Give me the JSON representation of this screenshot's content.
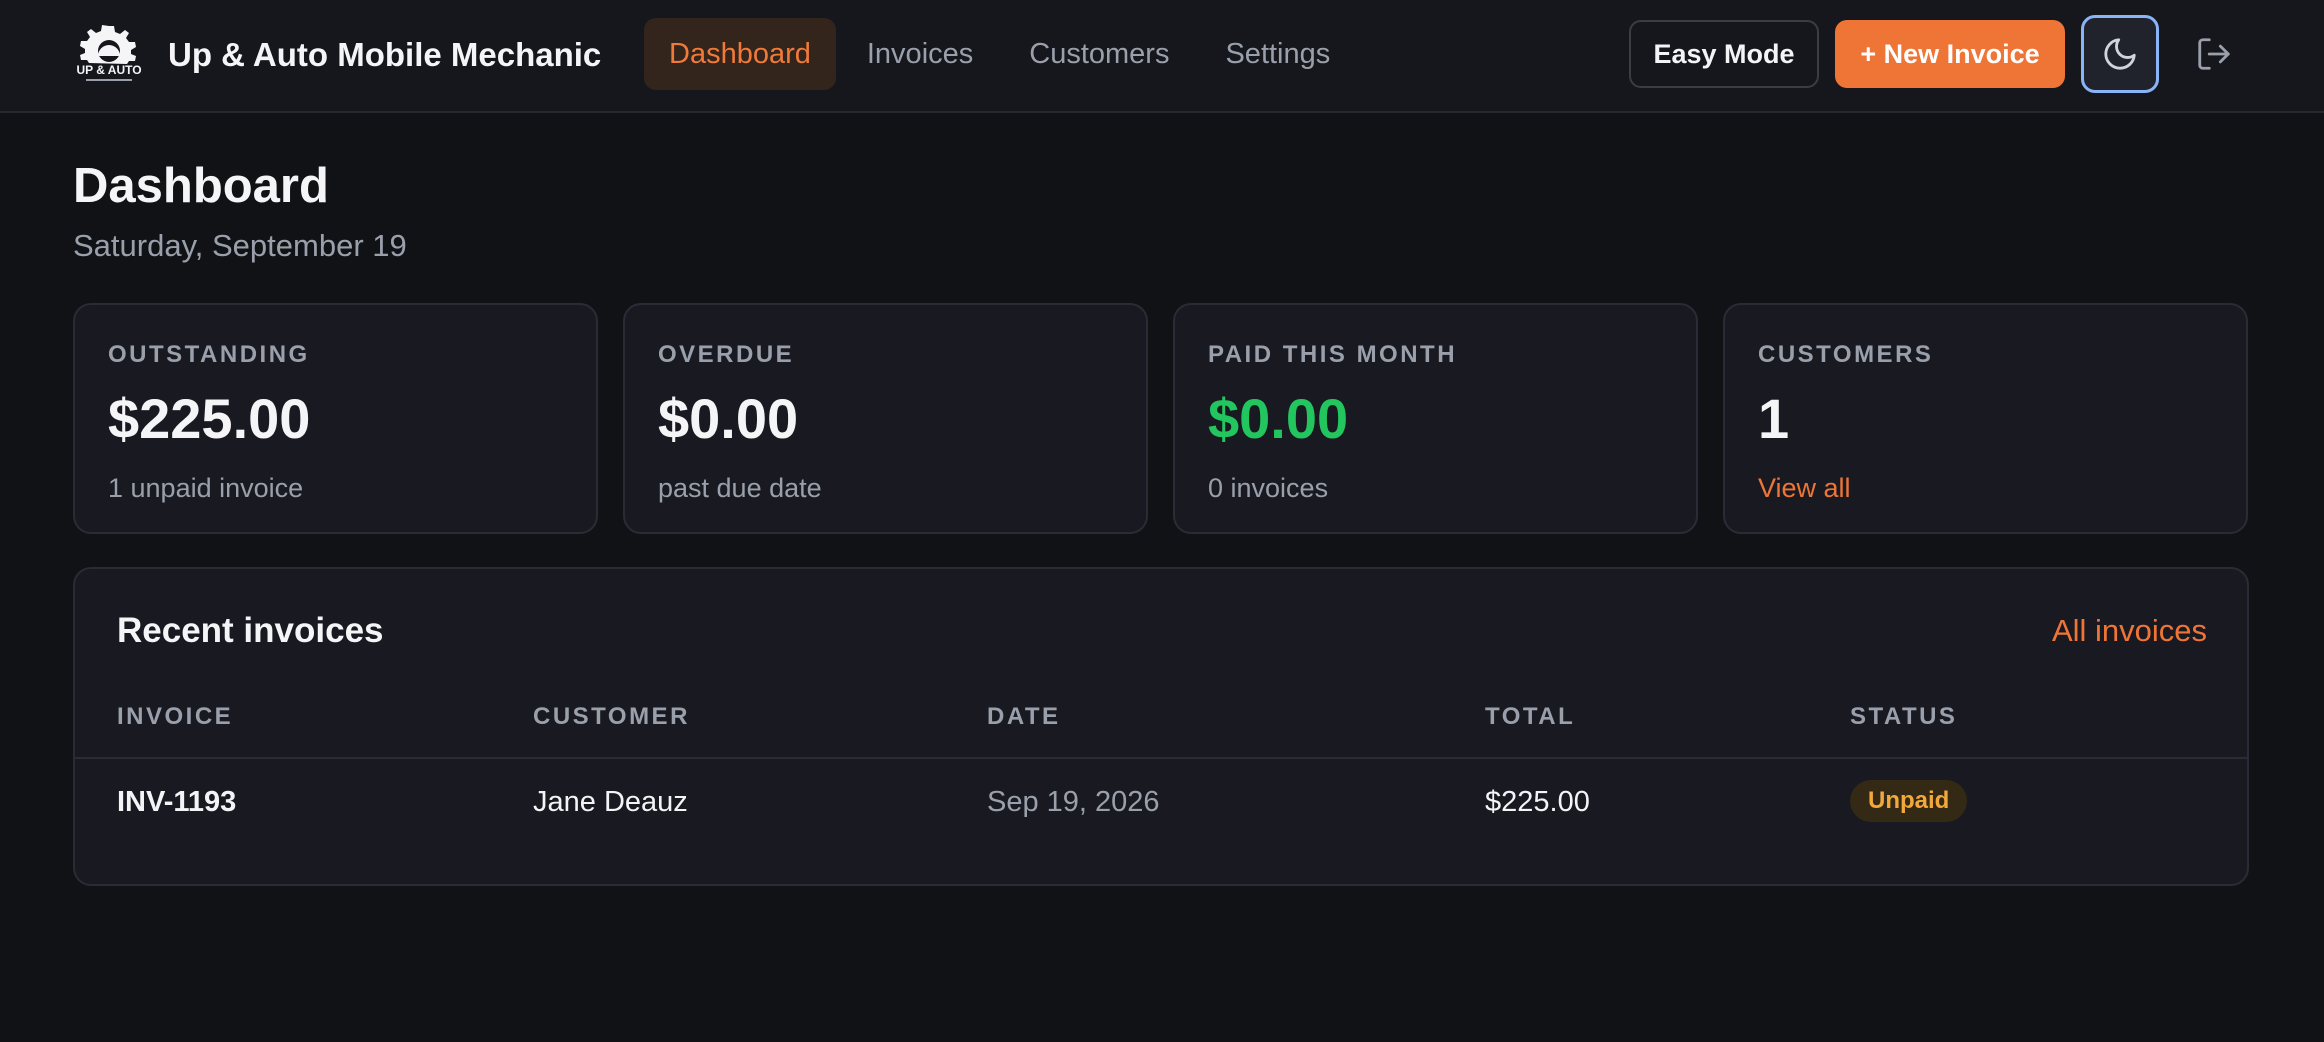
{
  "app": {
    "name": "Up & Auto Mobile Mechanic",
    "logo_text": "UP & AUTO"
  },
  "nav": {
    "items": [
      {
        "label": "Dashboard",
        "active": true
      },
      {
        "label": "Invoices",
        "active": false
      },
      {
        "label": "Customers",
        "active": false
      },
      {
        "label": "Settings",
        "active": false
      }
    ]
  },
  "toolbar": {
    "easy_mode_label": "Easy Mode",
    "new_invoice_label": "+ New Invoice",
    "theme_icon": "moon-icon",
    "logout_icon": "logout-icon"
  },
  "page": {
    "title": "Dashboard",
    "date": "Saturday, September 19"
  },
  "stats": [
    {
      "label": "OUTSTANDING",
      "value": "$225.00",
      "sub": "1 unpaid invoice"
    },
    {
      "label": "OVERDUE",
      "value": "$0.00",
      "sub": "past due date"
    },
    {
      "label": "PAID THIS MONTH",
      "value": "$0.00",
      "sub": "0 invoices"
    },
    {
      "label": "CUSTOMERS",
      "value": "1",
      "sub": "View all"
    }
  ],
  "recent": {
    "title": "Recent invoices",
    "all_link": "All invoices",
    "columns": [
      "INVOICE",
      "CUSTOMER",
      "DATE",
      "TOTAL",
      "STATUS"
    ],
    "rows": [
      {
        "invoice": "INV-1193",
        "customer": "Jane Deauz",
        "date": "Sep 19, 2026",
        "total": "$225.00",
        "status": "Unpaid"
      }
    ]
  },
  "colors": {
    "accent": "#ef7537",
    "success": "#22c55e",
    "warning": "#f2a83a",
    "background": "#111216",
    "surface": "#191a21"
  }
}
